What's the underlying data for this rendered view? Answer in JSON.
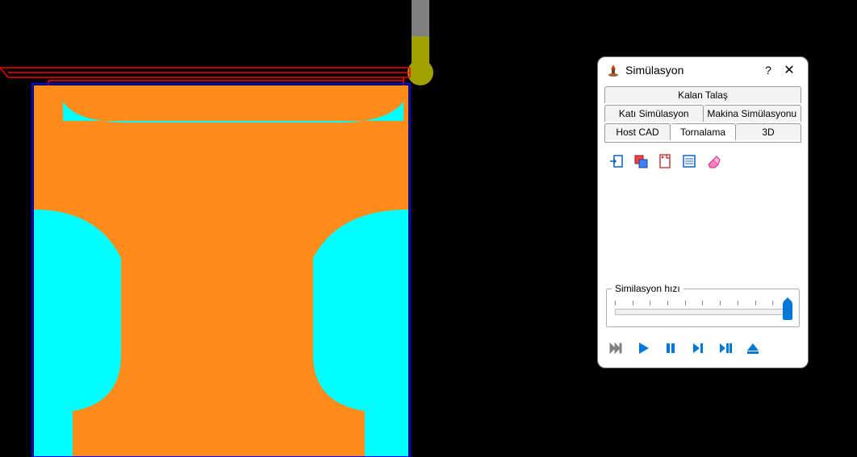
{
  "dialog": {
    "title": "Simülasyon",
    "help": "?",
    "close": "✕",
    "tabs_row1": [
      "Kalan Talaş"
    ],
    "tabs_row2": [
      "Katı Simülasyon",
      "Makina Simülasyonu"
    ],
    "tabs_row3": [
      "Host CAD",
      "Tornalama",
      "3D"
    ],
    "toolbar_icons": [
      "import-icon",
      "overlap-icon",
      "sheet-icon",
      "list-icon",
      "erase-icon"
    ],
    "speed": {
      "legend": "Similasyon hızı"
    },
    "playback_icons": [
      "fast-forward-disabled",
      "play",
      "pause",
      "next",
      "next-pause",
      "eject"
    ]
  }
}
